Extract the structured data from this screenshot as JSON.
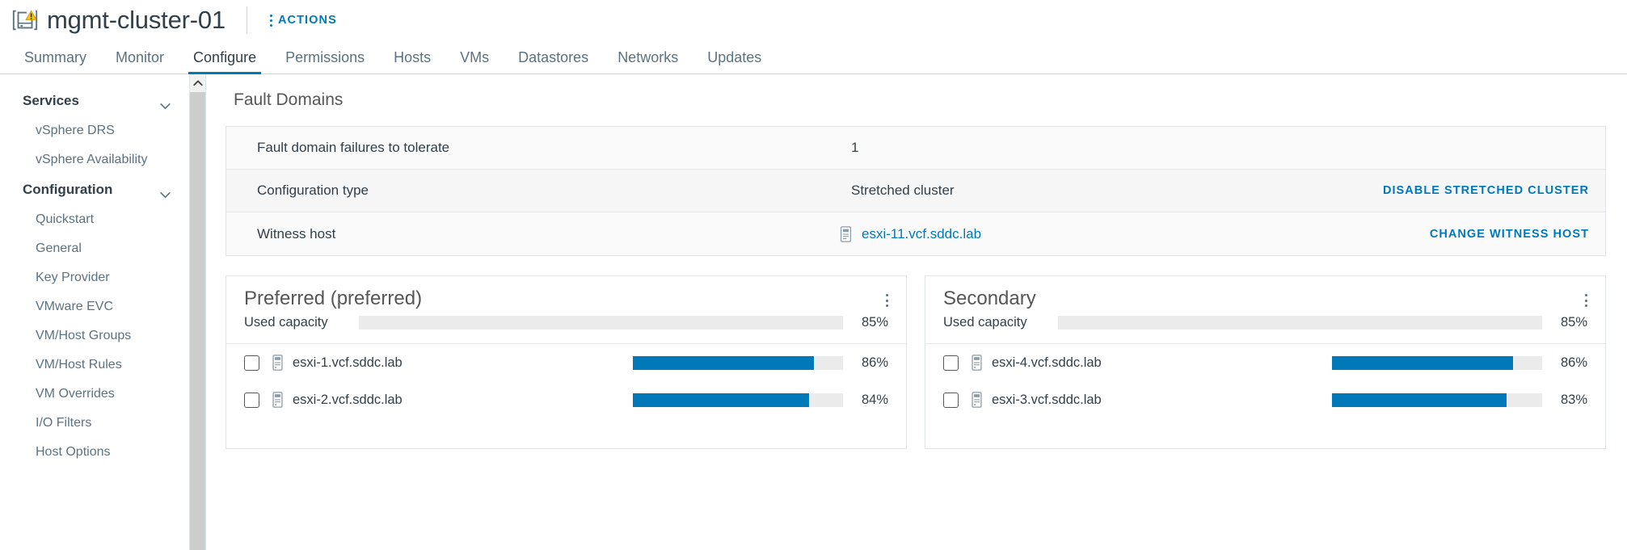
{
  "header": {
    "object_name": "mgmt-cluster-01",
    "object_icon": "cluster-warning-icon",
    "actions_label": "ACTIONS"
  },
  "tabs": [
    {
      "label": "Summary",
      "active": false
    },
    {
      "label": "Monitor",
      "active": false
    },
    {
      "label": "Configure",
      "active": true
    },
    {
      "label": "Permissions",
      "active": false
    },
    {
      "label": "Hosts",
      "active": false
    },
    {
      "label": "VMs",
      "active": false
    },
    {
      "label": "Datastores",
      "active": false
    },
    {
      "label": "Networks",
      "active": false
    },
    {
      "label": "Updates",
      "active": false
    }
  ],
  "sidebar": {
    "groups": [
      {
        "title": "Services",
        "expanded": true,
        "items": [
          "vSphere DRS",
          "vSphere Availability"
        ]
      },
      {
        "title": "Configuration",
        "expanded": true,
        "items": [
          "Quickstart",
          "General",
          "Key Provider",
          "VMware EVC",
          "VM/Host Groups",
          "VM/Host Rules",
          "VM Overrides",
          "I/O Filters",
          "Host Options"
        ]
      }
    ]
  },
  "main": {
    "section_title": "Fault Domains",
    "info_rows": [
      {
        "label": "Fault domain failures to tolerate",
        "value": "1",
        "action": ""
      },
      {
        "label": "Configuration type",
        "value": "Stretched cluster",
        "action": "DISABLE STRETCHED CLUSTER"
      },
      {
        "label": "Witness host",
        "value": "esxi-11.vcf.sddc.lab",
        "action": "CHANGE WITNESS HOST",
        "value_is_link": true
      }
    ],
    "fault_domains": [
      {
        "name": "Preferred (preferred)",
        "capacity_label": "Used capacity",
        "capacity_percent": "85%",
        "capacity_value": 85,
        "hosts": [
          {
            "name": "esxi-1.vcf.sddc.lab",
            "percent": "86%",
            "value": 86,
            "checked": false
          },
          {
            "name": "esxi-2.vcf.sddc.lab",
            "percent": "84%",
            "value": 84,
            "checked": false
          }
        ]
      },
      {
        "name": "Secondary",
        "capacity_label": "Used capacity",
        "capacity_percent": "85%",
        "capacity_value": 85,
        "hosts": [
          {
            "name": "esxi-4.vcf.sddc.lab",
            "percent": "86%",
            "value": 86,
            "checked": false
          },
          {
            "name": "esxi-3.vcf.sddc.lab",
            "percent": "83%",
            "value": 83,
            "checked": false
          }
        ]
      }
    ]
  },
  "colors": {
    "accent": "#0079b8",
    "bar_fill": "#0079b8",
    "bar_track": "#ebebeb",
    "text": "#31404b",
    "muted": "#5b7282",
    "warning": "#fac400"
  }
}
